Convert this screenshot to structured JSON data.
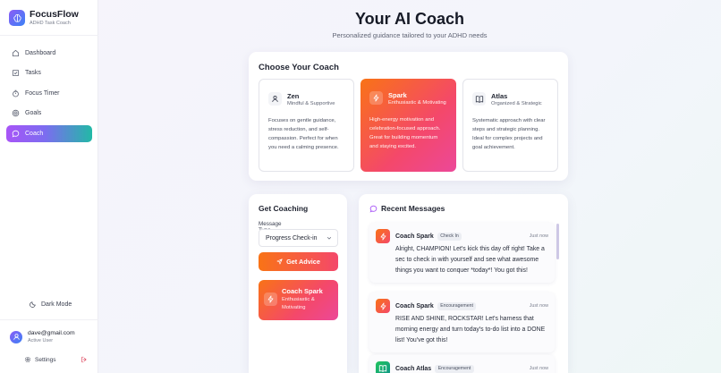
{
  "app": {
    "name": "FocusFlow",
    "tagline": "ADHD Task Coach"
  },
  "nav": [
    {
      "label": "Dashboard",
      "icon": "home-icon"
    },
    {
      "label": "Tasks",
      "icon": "checkbox-icon"
    },
    {
      "label": "Focus Timer",
      "icon": "timer-icon"
    },
    {
      "label": "Goals",
      "icon": "target-icon"
    },
    {
      "label": "Coach",
      "icon": "chat-bubble-icon",
      "active": true
    }
  ],
  "dark_mode_label": "Dark Mode",
  "user": {
    "email": "dave@gmail.com",
    "status": "Active User"
  },
  "settings_label": "Settings",
  "header": {
    "title": "Your AI Coach",
    "subtitle": "Personalized guidance tailored to your ADHD needs"
  },
  "choose": {
    "title": "Choose Your Coach",
    "coaches": [
      {
        "name": "Zen",
        "tagline": "Mindful & Supportive",
        "icon": "person-icon",
        "description": "Focuses on gentle guidance, stress reduction, and self-compassion. Perfect for when you need a calming presence."
      },
      {
        "name": "Spark",
        "tagline": "Enthusiastic & Motivating",
        "icon": "zap-icon",
        "selected": true,
        "description": "High-energy motivation and celebration-focused approach. Great for building momentum and staying excited."
      },
      {
        "name": "Atlas",
        "tagline": "Organized & Strategic",
        "icon": "book-icon",
        "description": "Systematic approach with clear steps and strategic planning. Ideal for complex projects and goal achievement."
      }
    ]
  },
  "get_coaching": {
    "title": "Get Coaching",
    "message_type_label": "Message Type",
    "message_type_value": "Progress Check-in",
    "button_label": "Get Advice",
    "selected_coach": {
      "name": "Coach Spark",
      "tagline": "Enthusiastic & Motivating"
    }
  },
  "messages": {
    "title": "Recent Messages",
    "items": [
      {
        "author": "Coach Spark",
        "badge": "Check In",
        "time": "Just now",
        "text": "Alright, CHAMPION! Let's kick this day off right! Take a sec to check in with yourself and see what awesome things you want to conquer *today*! You got this!"
      },
      {
        "author": "Coach Spark",
        "badge": "Encouragement",
        "time": "Just now",
        "text": "RISE AND SHINE, ROCKSTAR! Let's harness that morning energy and turn today's to-do list into a DONE list! You've got this!"
      },
      {
        "author": "Coach Atlas",
        "badge": "Encouragement",
        "time": "Just now",
        "text": ""
      }
    ]
  },
  "colors": {
    "accent_purple": "#a855f7",
    "accent_teal": "#22b9a6",
    "spark_orange": "#f97316",
    "spark_pink": "#f4486a"
  }
}
